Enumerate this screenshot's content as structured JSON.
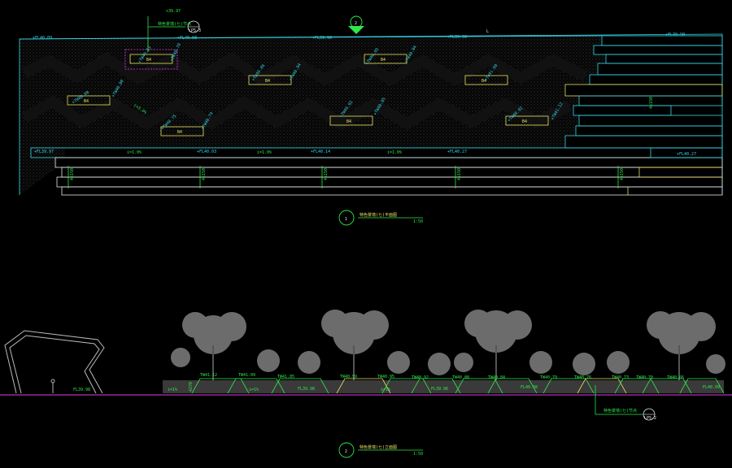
{
  "drawing": {
    "plan_view": {
      "callout": {
        "number": "1",
        "title": "特色景墙(七)平面图",
        "scale": "1:50"
      },
      "top_elevation": "+39.97",
      "detail_ref": {
        "label": "特色景墙(七)节点",
        "sheet": "LP5-3"
      },
      "section_ref": "2",
      "corner_mark": "L",
      "top_levels": [
        "+FL40.09",
        "+FL40.08",
        "+FL39.96",
        "+FL39.90",
        "+FL39.98"
      ],
      "wall_levels": [
        "+TW40.53",
        "+TW40.78",
        "+TW40.86",
        "+TW40.95",
        "+TW40.84",
        "+TW41.00",
        "+TW40.94",
        "+TW40.80",
        "+TW40.08",
        "+TW40.75",
        "+TW40.79",
        "+TW40.92",
        "+TW40.85",
        "+TW40.92",
        "+TW41.12"
      ],
      "blocks": [
        "B4",
        "B4",
        "B4",
        "B4",
        "B4",
        "B4",
        "B4",
        "B4"
      ],
      "slopes": [
        "i=3.0%",
        "i=1.0%",
        "i=1.0%",
        "i=1.0%"
      ],
      "step_levels": [
        "+FL39.97",
        "+FL40.03",
        "+FL40.14",
        "+FL40.27",
        "+FL40.27"
      ],
      "step_counts": [
        "4x150",
        "4x150",
        "4x150",
        "4x150",
        "4x150"
      ],
      "step_label": "4x150"
    },
    "elevation_view": {
      "callout": {
        "number": "2",
        "title": "特色景墙(七)立面图",
        "scale": "1:50"
      },
      "tw_levels": [
        "TW41.12",
        "TW41.09",
        "TW41.85",
        "TW40.99",
        "TW40.95",
        "TW40.92",
        "TW40.88",
        "TW40.84",
        "TW40.79",
        "TW40.76",
        "TW40.73",
        "TW40.70",
        "TW40.66"
      ],
      "fl_levels": [
        "FL39.98",
        "FL39.98",
        "FL39.96",
        "FL40.08",
        "FL40.09"
      ],
      "small_marks": [
        "i=1%",
        "i=1%",
        "i=1%"
      ],
      "height_mark": "4270",
      "detail_ref": {
        "label": "特色景墙(七)节点",
        "sheet": "LP5-2"
      }
    }
  }
}
